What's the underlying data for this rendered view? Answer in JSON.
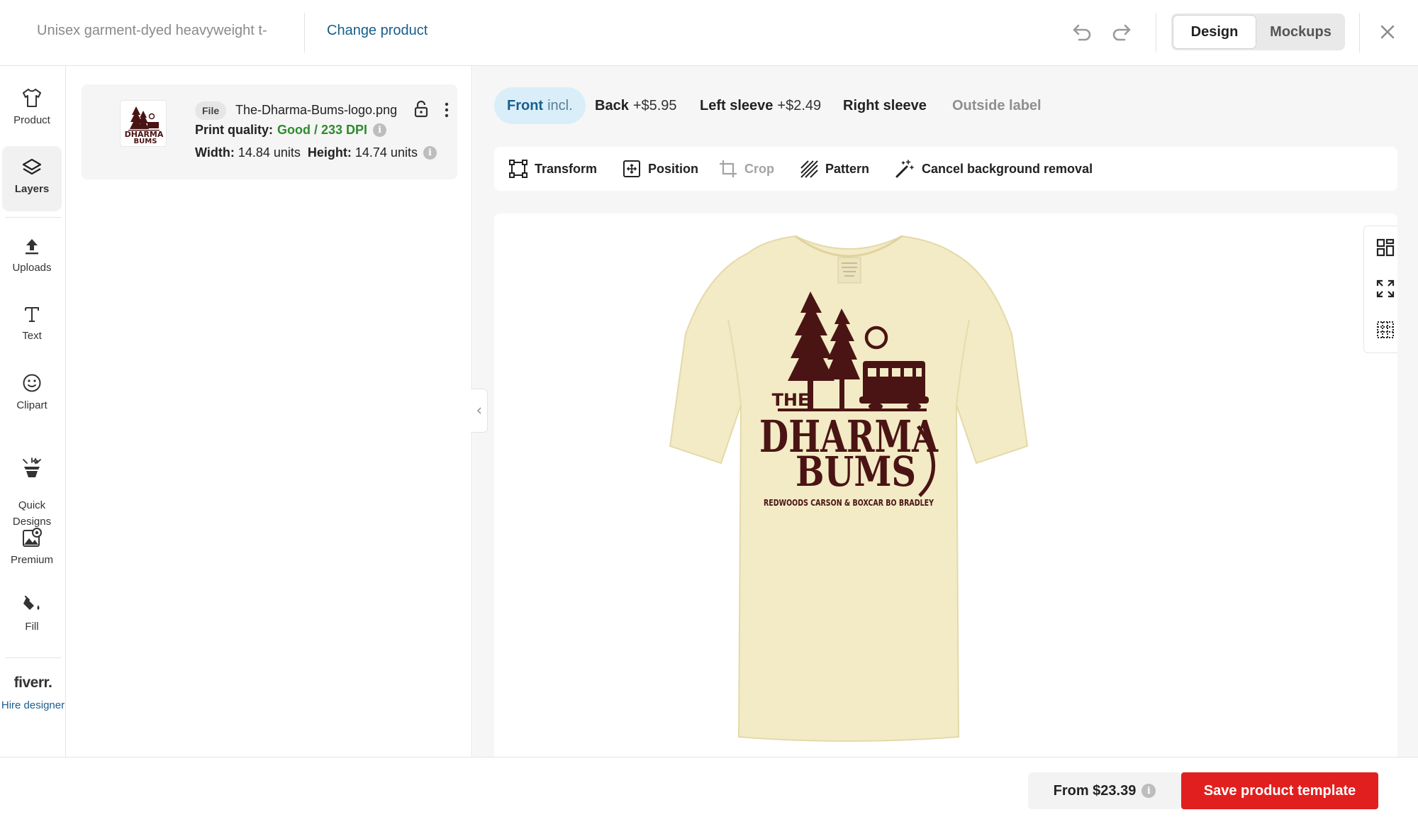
{
  "header": {
    "product_name": "Unisex garment-dyed heavyweight t-",
    "change_product_label": "Change product",
    "view_toggle": {
      "design_label": "Design",
      "mockups_label": "Mockups",
      "selected": "Design"
    }
  },
  "sidebar": {
    "items": [
      {
        "label": "Product",
        "icon": "tshirt-icon"
      },
      {
        "label": "Layers",
        "icon": "layers-icon",
        "active": true
      },
      {
        "label": "Uploads",
        "icon": "upload-icon"
      },
      {
        "label": "Text",
        "icon": "text-icon"
      },
      {
        "label": "Clipart",
        "icon": "smiley-icon"
      },
      {
        "label": "Quick\nDesigns",
        "icon": "sparkle-icon"
      },
      {
        "label": "Premium",
        "icon": "premium-image-icon"
      },
      {
        "label": "Fill",
        "icon": "paint-bucket-icon"
      }
    ],
    "fiverr_logo": "fiverr.",
    "hire_designer_label": "Hire designer"
  },
  "layers": {
    "file_badge": "File",
    "file_name": "The-Dharma-Bums-logo.png",
    "print_quality_label": "Print quality:",
    "print_quality_value": "Good / 233 DPI",
    "width_label": "Width:",
    "width_value": "14.84 units",
    "height_label": "Height:",
    "height_value": "14.74 units"
  },
  "placements": {
    "tabs": [
      {
        "label": "Front",
        "sub": "incl.",
        "active": true
      },
      {
        "label": "Back",
        "sub": "+$5.95"
      },
      {
        "label": "Left sleeve",
        "sub": "+$2.49"
      },
      {
        "label": "Right sleeve",
        "sub": ""
      },
      {
        "label": "Outside label",
        "sub": "",
        "disabled": true
      }
    ]
  },
  "toolbar": {
    "transform_label": "Transform",
    "position_label": "Position",
    "crop_label": "Crop",
    "pattern_label": "Pattern",
    "cancel_bg_label": "Cancel background removal"
  },
  "design": {
    "logo_the": "THE",
    "logo_line1": "DHARMA",
    "logo_line2": "BUMS",
    "logo_tagline": "REDWOODS CARSON & BOXCAR BO BRADLEY",
    "shirt_color": "#f3ebc6",
    "ink_color": "#4a1414"
  },
  "footer": {
    "price_label": "From $23.39",
    "save_label": "Save product template"
  },
  "colors": {
    "accent_blue": "#175e8a",
    "save_red": "#e11f1f",
    "quality_green": "#2e8b2e"
  }
}
